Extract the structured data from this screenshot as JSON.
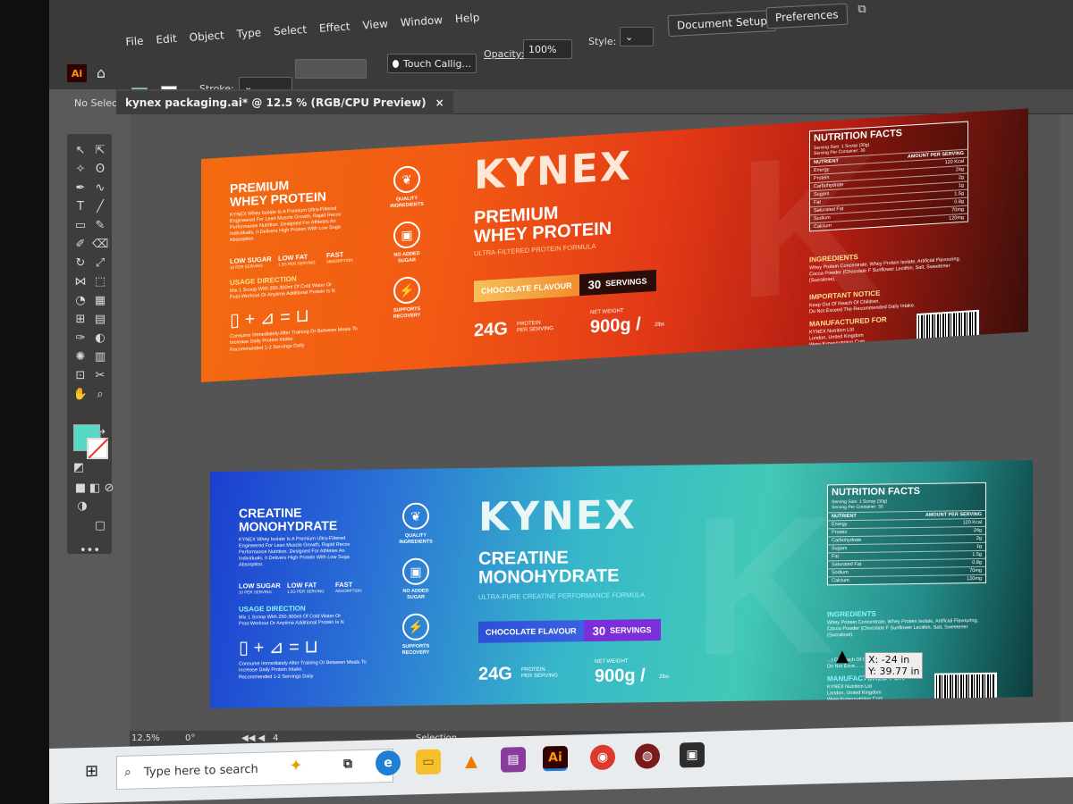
{
  "menu": [
    "File",
    "Edit",
    "Object",
    "Type",
    "Select",
    "Effect",
    "View",
    "Window",
    "Help"
  ],
  "control_bar": {
    "selection": "No Selection",
    "stroke_label": "Stroke:",
    "brush": "Touch Callig...",
    "opacity_label": "Opacity:",
    "opacity_value": "100%",
    "style_label": "Style:",
    "document_setup": "Document Setup",
    "preferences": "Preferences"
  },
  "app": {
    "logo": "Ai"
  },
  "tab": {
    "title": "kynex packaging.ai* @ 12.5 % (RGB/CPU Preview)",
    "close": "×"
  },
  "colors": {
    "fill": "#58d8c6",
    "accent_orange": "#f36b10",
    "accent_teal": "#43c9b7"
  },
  "labels": [
    {
      "id": "whey",
      "side_title": "PREMIUM\nWHEY PROTEIN",
      "side_desc": "KYNEX Whey Isolate Is A Premium Ultra-Filtered Engineered For Lean Muscle Growth, Rapid Recov Performance Nutrition. Designed For Athletes An Individuals, It Delivers High Protein With Low Suga Absorption.",
      "claims": [
        [
          "LOW SUGAR",
          "10 PER SERVING"
        ],
        [
          "LOW FAT",
          "1.5G PER SERVING"
        ],
        [
          "FAST",
          "ABSORPTION"
        ]
      ],
      "usage_title": "USAGE DIRECTION",
      "usage_text": "Mix 1 Scoop With 250-300ml Of Cold Water Or Post-Workout Or Anytime Additional Protein Is N",
      "usage_note": "Consume Immediately After Training Or Between Meals To Increase Daily Protein Intake.",
      "usage_rec": "Recommended 1-2 Servings Daily",
      "icons": [
        [
          "QUALITY",
          "INGREDIENTS"
        ],
        [
          "NO ADDED",
          "SUGAR"
        ],
        [
          "SUPPORTS",
          "RECOVERY"
        ]
      ],
      "brand": "KYNEX",
      "product": "PREMIUM\nWHEY PROTEIN",
      "tagline": "ULTRA-FILTERED PROTEIN FORMULA",
      "flavour": "CHOCOLATE FLAVOUR",
      "servings_num": "30",
      "servings_word": "SERVINGS",
      "protein": "24G",
      "protein_label": "PROTEIN\nPER SERVING",
      "net_label": "NET WEIGHT",
      "weight": "900g /",
      "weight_lbs": "2lbs",
      "nf_title": "NUTRITION FACTS",
      "nf_serving": "Serving Size: 1 Scoop (30g)\nServing Per Container: 30",
      "nf_head": [
        "NUTRIENT",
        "AMOUNT PER SERVING"
      ],
      "nf_rows": [
        [
          "Energy",
          "120 Kcal"
        ],
        [
          "Protein",
          "24g"
        ],
        [
          "Carbohydrate",
          "2g"
        ],
        [
          "Sugars",
          "1g"
        ],
        [
          "Fat",
          "1.5g"
        ],
        [
          "Saturated Fat",
          "0.8g"
        ],
        [
          "Sodium",
          "70mg"
        ],
        [
          "Calcium",
          "120mg"
        ]
      ],
      "ingredients_title": "INGREDIENTS",
      "ingredients": "Whey Protein Concentrate, Whey Protein Isolate, Artificial Flavouring, Cocoa Powder (Chocolate F Sunflower Lecithin, Salt, Sweetener (Sucralose).",
      "notice_title": "IMPORTANT NOTICE",
      "notice": "Keep Out Of Reach Of Children.\nDo Not Exceed The Recommended Daily Intake.",
      "mfr_title": "MANUFACTURED FOR",
      "mfr": "KYNEX Nutrition Ltd\nLondon, United Kingdom\nWww.Kynexnutrition.Com\nSupport@Kynexnutrition.Com"
    },
    {
      "id": "creatine",
      "side_title": "CREATINE\nMONOHYDRATE",
      "side_desc": "KYNEX Whey Isolate Is A Premium Ultra-Filtered Engineered For Lean Muscle Growth, Rapid Recov Performance Nutrition. Designed For Athletes An Individuals, It Delivers High Protein With Low Suga Absorption.",
      "claims": [
        [
          "LOW SUGAR",
          "10 PER SERVING"
        ],
        [
          "LOW FAT",
          "1.5G PER SERVING"
        ],
        [
          "FAST",
          "ABSORPTION"
        ]
      ],
      "usage_title": "USAGE DIRECTION",
      "usage_text": "Mix 1 Scoop With 250-300ml Of Cold Water Or Post-Workout Or Anytime Additional Protein Is N",
      "usage_note": "Consume Immediately After Training Or Between Meals To Increase Daily Protein Intake.",
      "usage_rec": "Recommended 1-2 Servings Daily",
      "icons": [
        [
          "QUALITY",
          "INGREDIENTS"
        ],
        [
          "NO ADDED",
          "SUGAR"
        ],
        [
          "SUPPORTS",
          "RECOVERY"
        ]
      ],
      "brand": "KYNEX",
      "product": "CREATINE\nMONOHYDRATE",
      "tagline": "ULTRA-PURE CREATINE PERFORMANCE FORMULA",
      "flavour": "CHOCOLATE FLAVOUR",
      "servings_num": "30",
      "servings_word": "SERVINGS",
      "protein": "24G",
      "protein_label": "PROTEIN\nPER SERVING",
      "net_label": "NET WEIGHT",
      "weight": "900g /",
      "weight_lbs": "2lbs",
      "nf_title": "NUTRITION FACTS",
      "nf_serving": "Serving Size: 1 Scoop (30g)\nServing Per Container: 30",
      "nf_head": [
        "NUTRIENT",
        "AMOUNT PER SERVING"
      ],
      "nf_rows": [
        [
          "Energy",
          "120 Kcal"
        ],
        [
          "Protein",
          "24g"
        ],
        [
          "Carbohydrate",
          "2g"
        ],
        [
          "Sugars",
          "1g"
        ],
        [
          "Fat",
          "1.5g"
        ],
        [
          "Saturated Fat",
          "0.8g"
        ],
        [
          "Sodium",
          "70mg"
        ],
        [
          "Calcium",
          "120mg"
        ]
      ],
      "ingredients_title": "INGREDIENTS",
      "ingredients": "Whey Protein Concentrate, Whey Protein Isolate, Artificial Flavouring, Cocoa Powder (Chocolate F Sunflower Lecithin, Salt, Sweetener (Sucralose).",
      "notice_title": "",
      "notice": "...t Of Reach Of Children.\nDo Not Exce... ...ed Daily Intake.",
      "mfr_title": "MANUFACTURED FOR",
      "mfr": "KYNEX Nutrition Ltd\nLondon, United Kingdom\nWww.Kynexnutrition.Com\nSupport@Kynexnutrition.Com"
    }
  ],
  "cursor_tip": {
    "x": "X: -24 in",
    "y": "Y: 39.77 in"
  },
  "status": {
    "zoom": "12.5%",
    "rotation": "0°",
    "artboard": "4",
    "mode": "Selection"
  },
  "taskbar": {
    "search_placeholder": "Type here to search"
  }
}
